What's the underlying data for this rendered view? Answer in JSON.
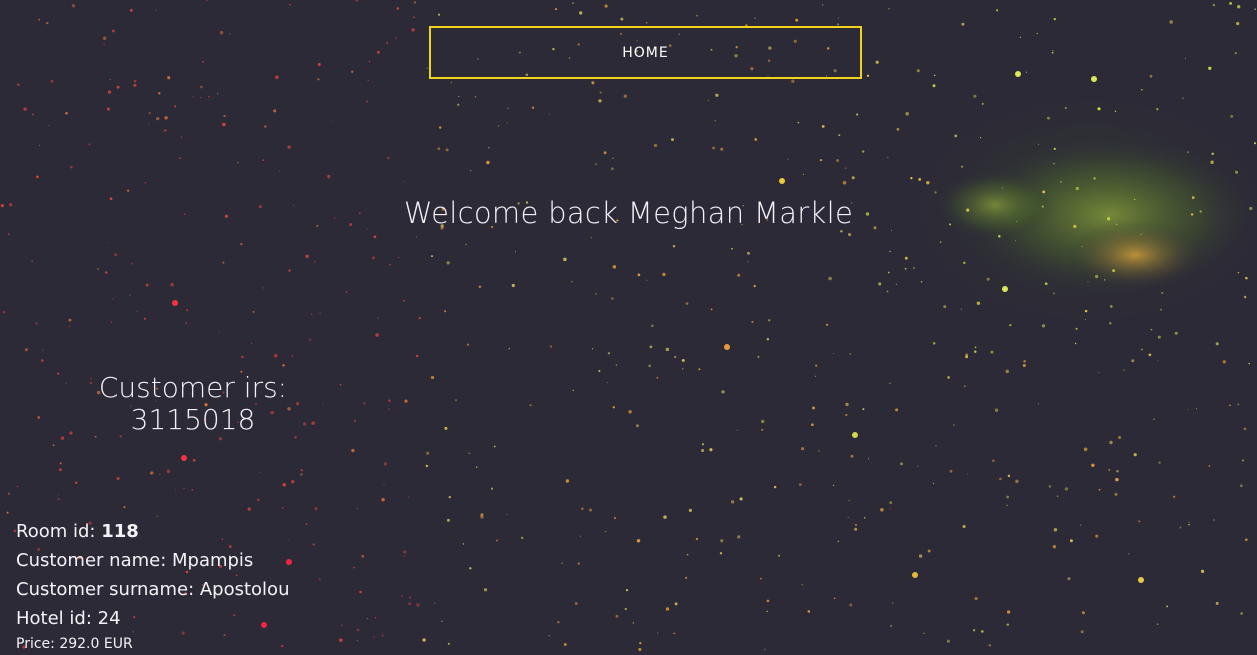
{
  "nav": {
    "home_label": "HOME"
  },
  "welcome": {
    "text": "Welcome back Meghan Markle"
  },
  "customer_irs": {
    "label": "Customer irs:",
    "value": "3115018"
  },
  "details": {
    "room_id_label": "Room id: ",
    "room_id_value": "118",
    "customer_name": "Customer name: Mpampis",
    "customer_surname": "Customer surname: Apostolou",
    "hotel_id": "Hotel id: 24",
    "price": "Price: 292.0 EUR"
  },
  "colors": {
    "background": "#2c2a36",
    "nav_border": "#f2d31b",
    "text": "#f4f2f6",
    "nebula": "#6a8a2a"
  }
}
